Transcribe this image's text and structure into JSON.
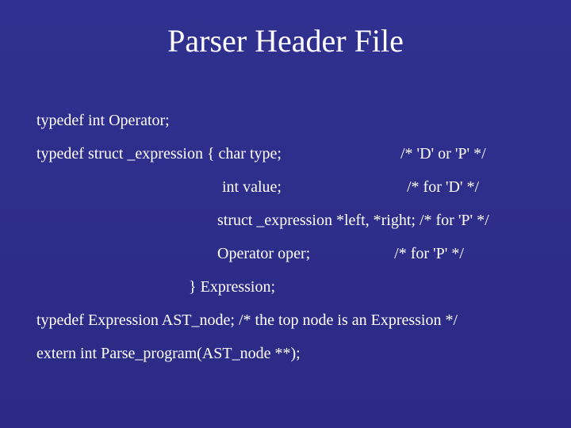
{
  "title": "Parser Header File",
  "code": {
    "l1": "typedef int Operator;",
    "l2a": "typedef struct _expression {   char type;",
    "l2b": "/* 'D' or 'P' */",
    "l3a": "int value;",
    "l3b": "/* for 'D' */",
    "l4": "struct _expression *left, *right; /* for 'P' */",
    "l5a": "Operator oper;",
    "l5b": "/* for 'P' */",
    "l6": "} Expression;",
    "l7": "typedef Expression AST_node;  /* the top node is an Expression */",
    "l8": "extern int Parse_program(AST_node **);"
  }
}
